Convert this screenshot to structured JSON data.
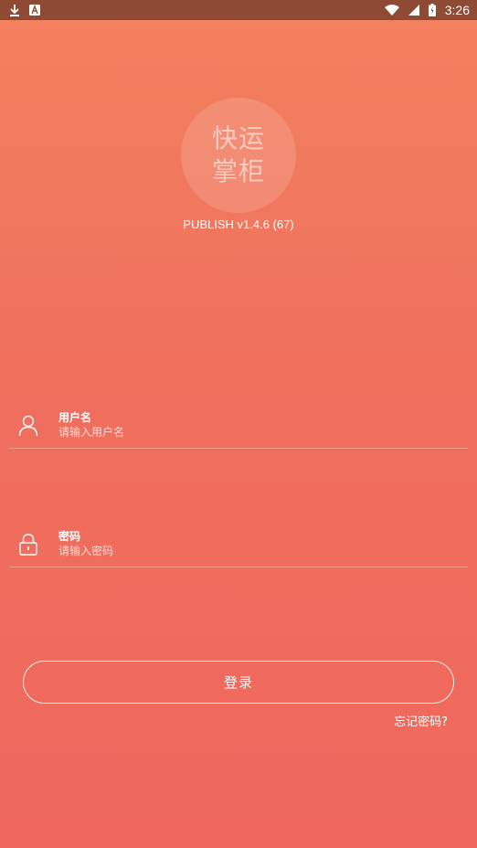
{
  "status_bar": {
    "time": "3:26",
    "left_icons": [
      "download-icon",
      "a-notification-icon"
    ],
    "right_icons": [
      "wifi-icon",
      "cell-signal-icon",
      "battery-icon"
    ],
    "background": "#8E4A33"
  },
  "logo": {
    "line1": "快运",
    "line2": "掌柜"
  },
  "version": "PUBLISH v1.4.6 (67)",
  "username": {
    "label": "用户名",
    "placeholder": "请输入用户名",
    "value": "",
    "icon": "user-icon"
  },
  "password": {
    "label": "密码",
    "placeholder": "请输入密码",
    "value": "",
    "icon": "lock-icon"
  },
  "login_button": "登录",
  "forgot_password": "忘记密码?",
  "colors": {
    "gradient_top": "#F2825F",
    "gradient_bottom": "#EF675D",
    "text": "#FFFFFF"
  }
}
